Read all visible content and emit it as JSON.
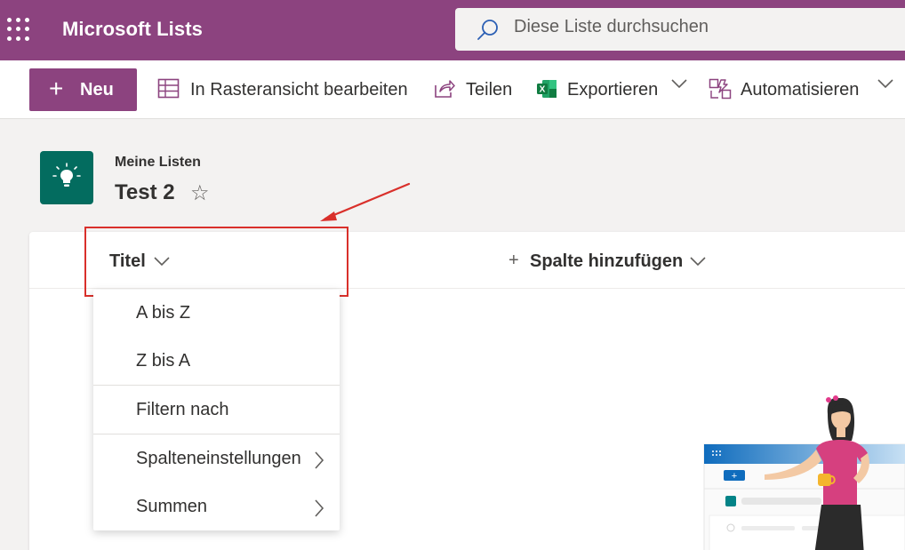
{
  "app": {
    "title": "Microsoft Lists",
    "brand_color": "#8c437f"
  },
  "search": {
    "placeholder": "Diese Liste durchsuchen"
  },
  "commandbar": {
    "new_label": "Neu",
    "grid_edit_label": "In Rasteransicht bearbeiten",
    "share_label": "Teilen",
    "export_label": "Exportieren",
    "automate_label": "Automatisieren"
  },
  "list": {
    "breadcrumb": "Meine Listen",
    "title": "Test 2",
    "icon": "lightbulb-icon",
    "icon_color": "#036c5f"
  },
  "columns": {
    "title_label": "Titel",
    "add_column_label": "Spalte hinzufügen"
  },
  "column_menu": {
    "items": [
      {
        "label": "A bis Z"
      },
      {
        "label": "Z bis A"
      },
      {
        "label": "Filtern nach"
      },
      {
        "label": "Spalteneinstellungen",
        "has_submenu": true
      },
      {
        "label": "Summen",
        "has_submenu": true
      }
    ]
  },
  "annotation": {
    "color": "#d9302b"
  }
}
